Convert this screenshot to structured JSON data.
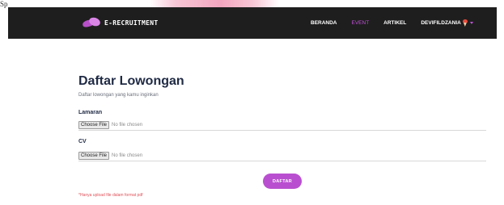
{
  "caption_fragment": "Sp",
  "navbar": {
    "brand": "E-RECRUITMENT",
    "items": [
      {
        "label": "BERANDA",
        "active": false
      },
      {
        "label": "EVENT",
        "active": true
      },
      {
        "label": "ARTIKEL",
        "active": false
      }
    ],
    "user": "DEVIFILDZANIA"
  },
  "page": {
    "title": "Daftar Lowongan",
    "subtitle": "Daftar lowongan yang kamu inginkan"
  },
  "form": {
    "fields": [
      {
        "label": "Lamaran",
        "button": "Choose File",
        "status": "No file chosen"
      },
      {
        "label": "CV",
        "button": "Choose File",
        "status": "No file chosen"
      }
    ],
    "submit_label": "DAFTAR",
    "note": "*Hanya upload file dalam format pdf"
  },
  "colors": {
    "navbar_bg": "#1e1e1e",
    "accent": "#b94fd0",
    "note": "#e0525a"
  }
}
